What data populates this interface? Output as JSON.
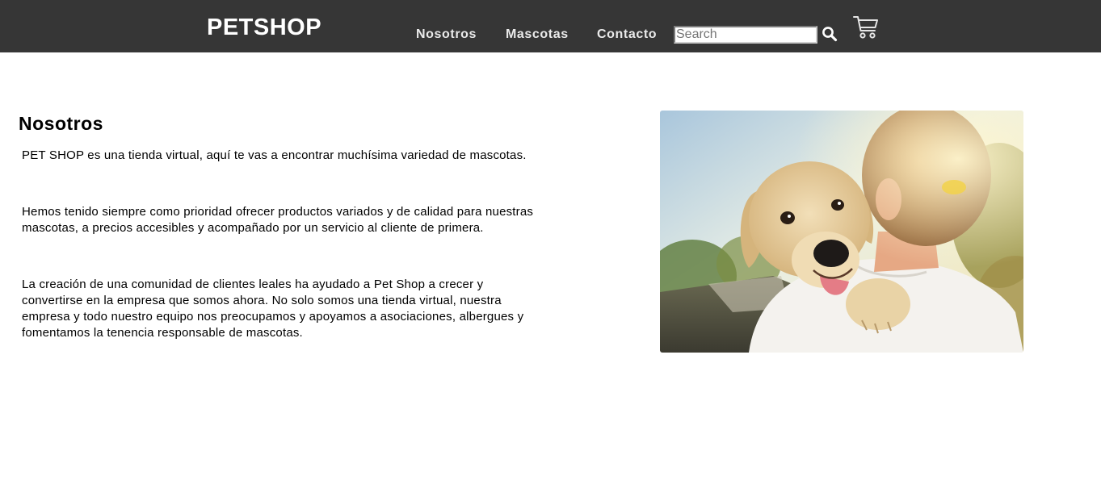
{
  "header": {
    "brand": "PETSHOP",
    "nav": [
      {
        "label": "Nosotros"
      },
      {
        "label": "Mascotas"
      },
      {
        "label": "Contacto"
      }
    ],
    "search": {
      "placeholder": "Search",
      "value": "",
      "icon": "search-icon"
    },
    "cart": {
      "icon": "cart-icon"
    }
  },
  "main": {
    "title": "Nosotros",
    "paragraphs": [
      "PET SHOP es una tienda virtual, aquí te vas a encontrar muchísima variedad de mascotas.",
      "Hemos tenido siempre como prioridad ofrecer productos variados y de calidad para nuestras mascotas, a precios accesibles y acompañado por un servicio al cliente de primera.",
      "La creación de una comunidad de clientes leales ha ayudado a Pet Shop a crecer y convertirse en la empresa que somos ahora. No solo somos una tienda virtual, nuestra empresa y todo nuestro equipo nos preocupamos y apoyamos a asociaciones, albergues y fomentamos la tenencia responsable de mascotas."
    ],
    "image": {
      "subject": "person-hugging-puppy"
    }
  },
  "colors": {
    "navbar_bg": "#363636",
    "nav_text": "#eaeaea",
    "page_bg": "#ffffff",
    "text": "#000000"
  }
}
